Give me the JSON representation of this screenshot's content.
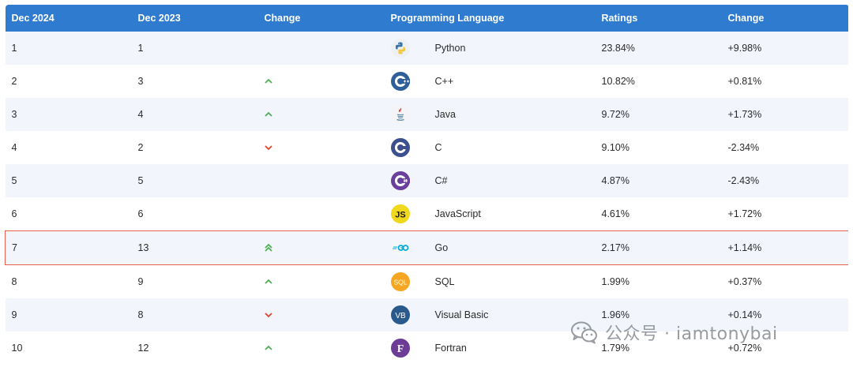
{
  "table": {
    "headers": [
      "Dec 2024",
      "Dec 2023",
      "Change",
      "Programming Language",
      "Ratings",
      "Change"
    ],
    "rows": [
      {
        "rank": "1",
        "prev": "1",
        "trend": "none",
        "logo": "python-logo-icon",
        "language": "Python",
        "ratings": "23.84%",
        "change": "+9.98%"
      },
      {
        "rank": "2",
        "prev": "3",
        "trend": "up",
        "logo": "cpp-logo-icon",
        "language": "C++",
        "ratings": "10.82%",
        "change": "+0.81%"
      },
      {
        "rank": "3",
        "prev": "4",
        "trend": "up",
        "logo": "java-logo-icon",
        "language": "Java",
        "ratings": "9.72%",
        "change": "+1.73%"
      },
      {
        "rank": "4",
        "prev": "2",
        "trend": "down",
        "logo": "c-logo-icon",
        "language": "C",
        "ratings": "9.10%",
        "change": "-2.34%"
      },
      {
        "rank": "5",
        "prev": "5",
        "trend": "none",
        "logo": "csharp-logo-icon",
        "language": "C#",
        "ratings": "4.87%",
        "change": "-2.43%"
      },
      {
        "rank": "6",
        "prev": "6",
        "trend": "none",
        "logo": "javascript-logo-icon",
        "language": "JavaScript",
        "ratings": "4.61%",
        "change": "+1.72%"
      },
      {
        "rank": "7",
        "prev": "13",
        "trend": "double-up",
        "logo": "go-logo-icon",
        "language": "Go",
        "ratings": "2.17%",
        "change": "+1.14%"
      },
      {
        "rank": "8",
        "prev": "9",
        "trend": "up",
        "logo": "sql-logo-icon",
        "language": "SQL",
        "ratings": "1.99%",
        "change": "+0.37%"
      },
      {
        "rank": "9",
        "prev": "8",
        "trend": "down",
        "logo": "visual-basic-logo-icon",
        "language": "Visual Basic",
        "ratings": "1.96%",
        "change": "+0.14%"
      },
      {
        "rank": "10",
        "prev": "12",
        "trend": "up",
        "logo": "fortran-logo-icon",
        "language": "Fortran",
        "ratings": "1.79%",
        "change": "+0.72%"
      }
    ],
    "logo_text": {
      "javascript": "JS",
      "sql": "SQL",
      "visual_basic": "VB",
      "fortran": "F"
    }
  },
  "watermark": {
    "text": "公众号 · iamtonybai",
    "icon": "wechat-icon"
  },
  "colors": {
    "header_bg": "#2f7bd0",
    "row_alt": "#f2f6fc",
    "up": "#4caf50",
    "down": "#e0442c",
    "highlight_border": "#e8604c"
  }
}
